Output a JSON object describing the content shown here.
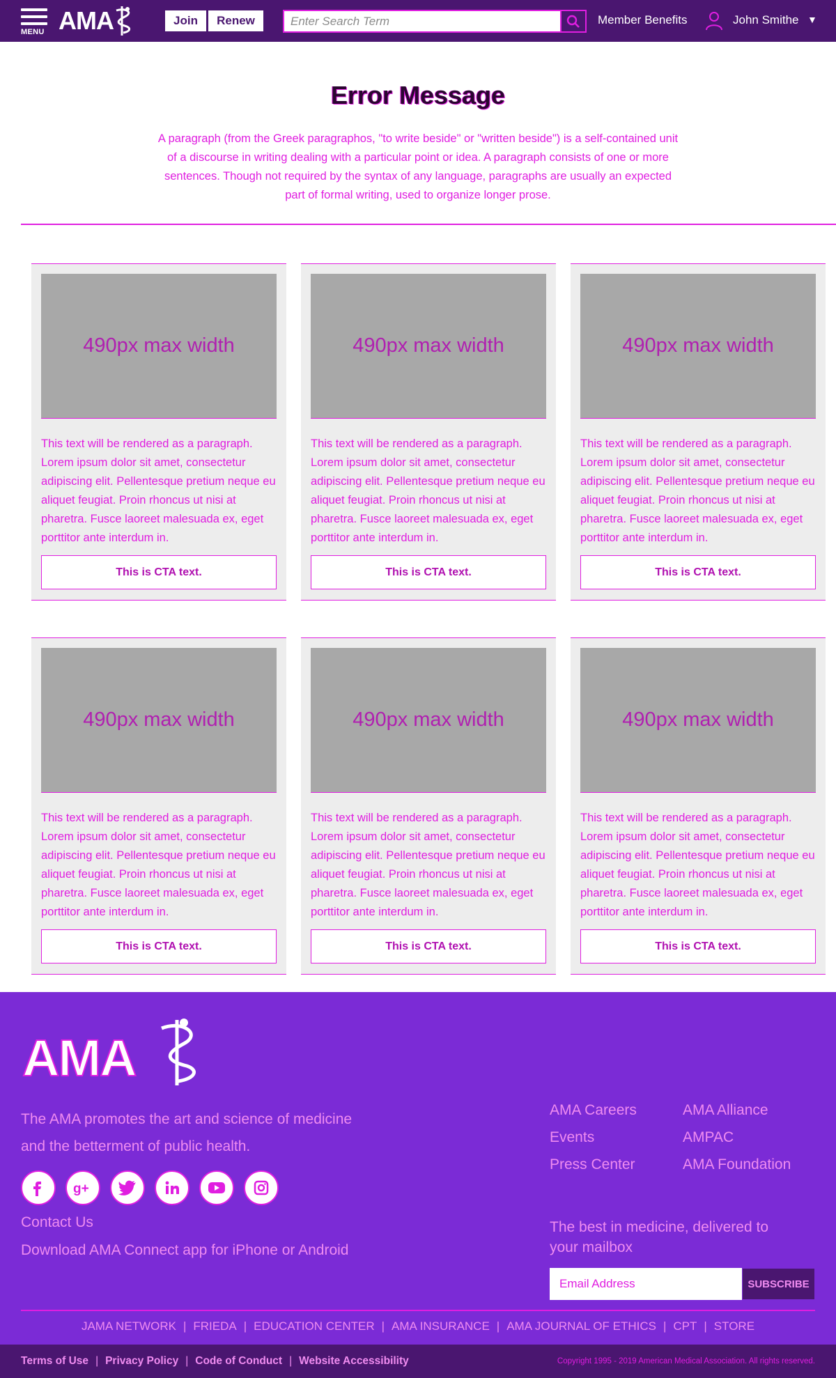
{
  "header": {
    "menu_label": "MENU",
    "logo_text": "AMA",
    "join_label": "Join",
    "renew_label": "Renew",
    "search_placeholder": "Enter Search Term",
    "member_benefits": "Member Benefits",
    "user_name": "John Smithe",
    "caret": "▼"
  },
  "hero": {
    "title": "Error Message",
    "paragraph": "A paragraph (from the Greek paragraphos, \"to write beside\" or \"written beside\") is a self-contained unit of a discourse in writing dealing with a particular point or idea. A paragraph consists of one or more sentences. Though not required by the syntax of any language, paragraphs are usually an expected part of formal writing, used to organize longer prose."
  },
  "cards": [
    {
      "image_label": "490px max width",
      "text": "This text will be rendered as a paragraph. Lorem ipsum dolor sit amet, consectetur adipiscing elit. Pellentesque pretium neque eu aliquet feugiat. Proin rhoncus ut nisi at pharetra. Fusce laoreet malesuada ex, eget porttitor ante interdum in.",
      "cta": "This is CTA text."
    },
    {
      "image_label": "490px max width",
      "text": "This text will be rendered as a paragraph. Lorem ipsum dolor sit amet, consectetur adipiscing elit. Pellentesque pretium neque eu aliquet feugiat. Proin rhoncus ut nisi at pharetra. Fusce laoreet malesuada ex, eget porttitor ante interdum in.",
      "cta": "This is CTA text."
    },
    {
      "image_label": "490px max width",
      "text": "This text will be rendered as a paragraph. Lorem ipsum dolor sit amet, consectetur adipiscing elit. Pellentesque pretium neque eu aliquet feugiat. Proin rhoncus ut nisi at pharetra. Fusce laoreet malesuada ex, eget porttitor ante interdum in.",
      "cta": "This is CTA text."
    },
    {
      "image_label": "490px max width",
      "text": "This text will be rendered as a paragraph. Lorem ipsum dolor sit amet, consectetur adipiscing elit. Pellentesque pretium neque eu aliquet feugiat. Proin rhoncus ut nisi at pharetra. Fusce laoreet malesuada ex, eget porttitor ante interdum in.",
      "cta": "This is CTA text."
    },
    {
      "image_label": "490px max width",
      "text": "This text will be rendered as a paragraph. Lorem ipsum dolor sit amet, consectetur adipiscing elit. Pellentesque pretium neque eu aliquet feugiat. Proin rhoncus ut nisi at pharetra. Fusce laoreet malesuada ex, eget porttitor ante interdum in.",
      "cta": "This is CTA text."
    },
    {
      "image_label": "490px max width",
      "text": "This text will be rendered as a paragraph. Lorem ipsum dolor sit amet, consectetur adipiscing elit. Pellentesque pretium neque eu aliquet feugiat. Proin rhoncus ut nisi at pharetra. Fusce laoreet malesuada ex, eget porttitor ante interdum in.",
      "cta": "This is CTA text."
    }
  ],
  "footer": {
    "logo_text": "AMA",
    "description": "The AMA promotes the art and science of medicine and the betterment of public health.",
    "social_icons": [
      "facebook-icon",
      "google-plus-icon",
      "twitter-icon",
      "linkedin-icon",
      "youtube-icon",
      "instagram-icon"
    ],
    "contact": "Contact Us",
    "download": "Download AMA Connect app for iPhone or Android",
    "links": [
      "AMA Careers",
      "AMA Alliance",
      "Events",
      "AMPAC",
      "Press Center",
      "AMA Foundation"
    ],
    "tagline": "The best in medicine, delivered to your mailbox",
    "email_placeholder": "Email Address",
    "subscribe_label": "SUBSCRIBE",
    "network_links": [
      "JAMA NETWORK",
      "FRIEDA",
      "EDUCATION CENTER",
      "AMA INSURANCE",
      "AMA JOURNAL OF ETHICS",
      "CPT",
      "STORE"
    ],
    "legal_links": [
      "Terms of Use",
      "Privacy Policy",
      "Code of Conduct",
      "Website Accessibility"
    ],
    "copyright": "Copyright 1995 - 2019 American Medical Association. All rights reserved."
  },
  "colors": {
    "header_bg": "#4a1670",
    "footer_bg": "#7b2bd6",
    "accent": "#e01ee0",
    "card_bg": "#ededed",
    "image_placeholder": "#a8a8a8"
  }
}
